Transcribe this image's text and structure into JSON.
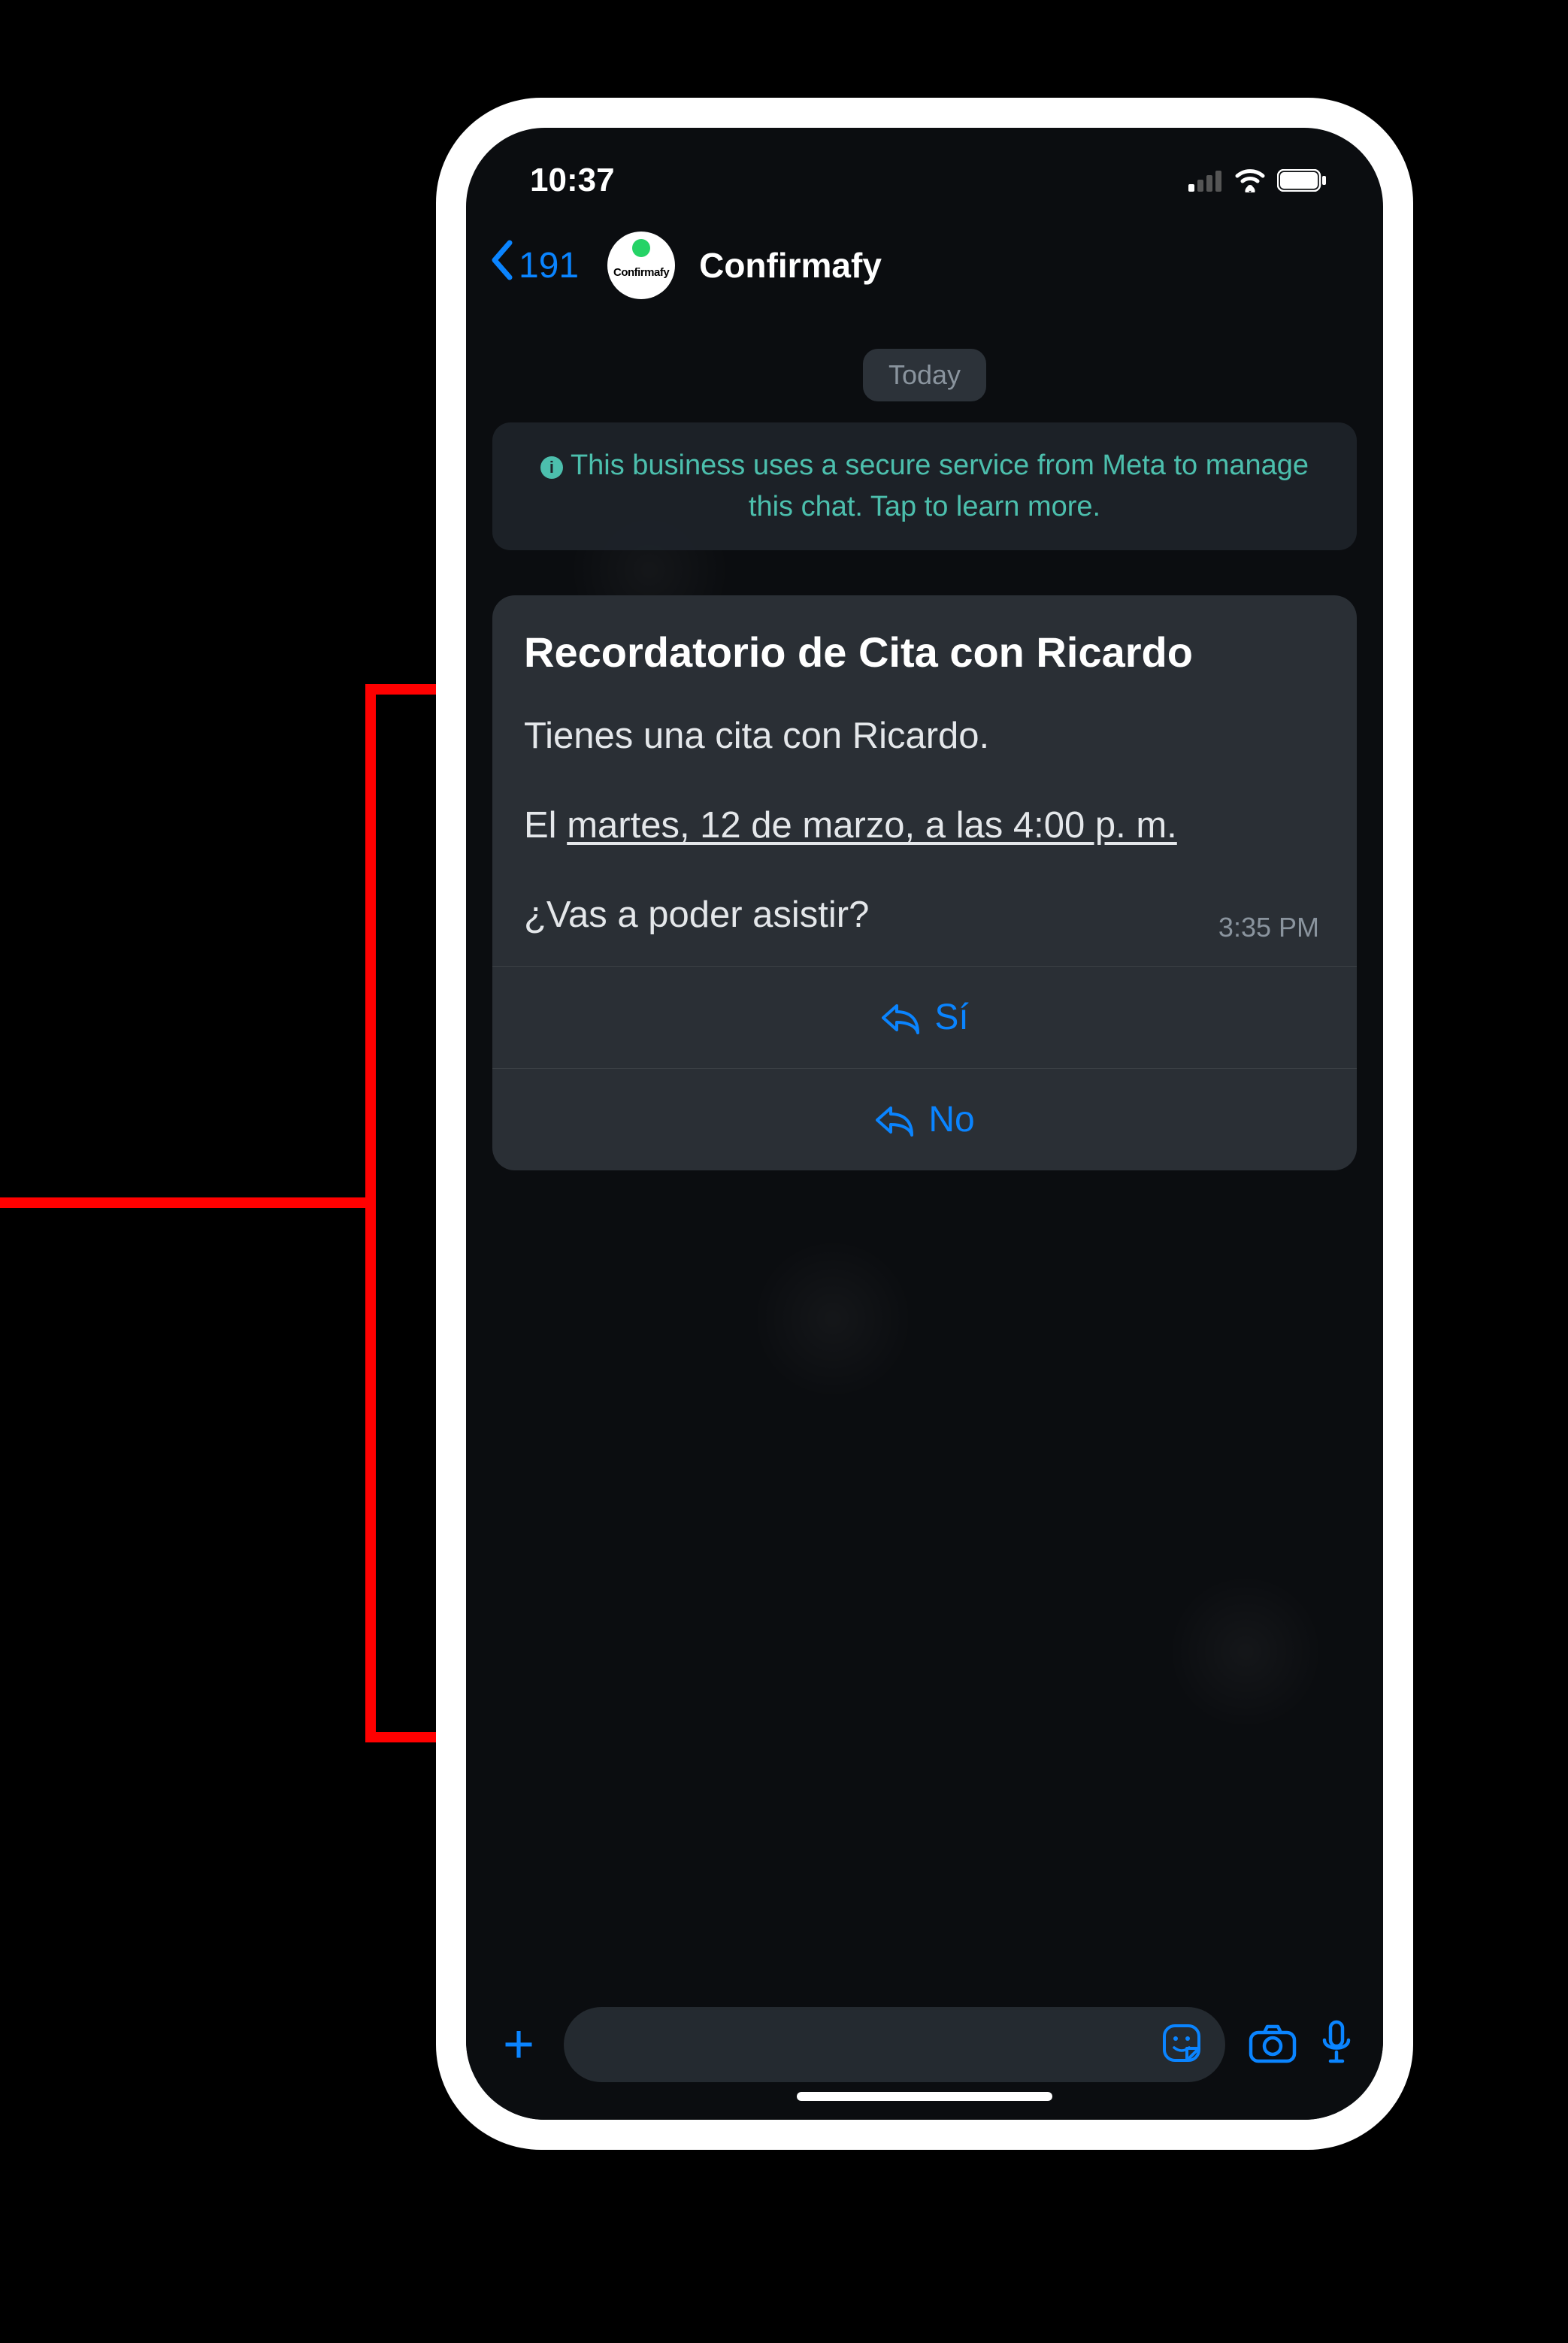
{
  "statusBar": {
    "time": "10:37"
  },
  "header": {
    "backCount": "191",
    "profileLabel": "Confirmafy",
    "title": "Confirmafy"
  },
  "chat": {
    "dateSeparator": "Today",
    "securityNotice": "This business uses a secure service from Meta to manage this chat. Tap to learn more.",
    "message": {
      "title": "Recordatorio de Cita con Ricardo",
      "line1": "Tienes una cita con Ricardo.",
      "line2a": "El ",
      "line2b": "martes, 12 de marzo, a las 4:00 p. m.",
      "line3": "¿Vas a poder asistir?",
      "time": "3:35 PM",
      "replyYes": "Sí",
      "replyNo": "No"
    }
  }
}
